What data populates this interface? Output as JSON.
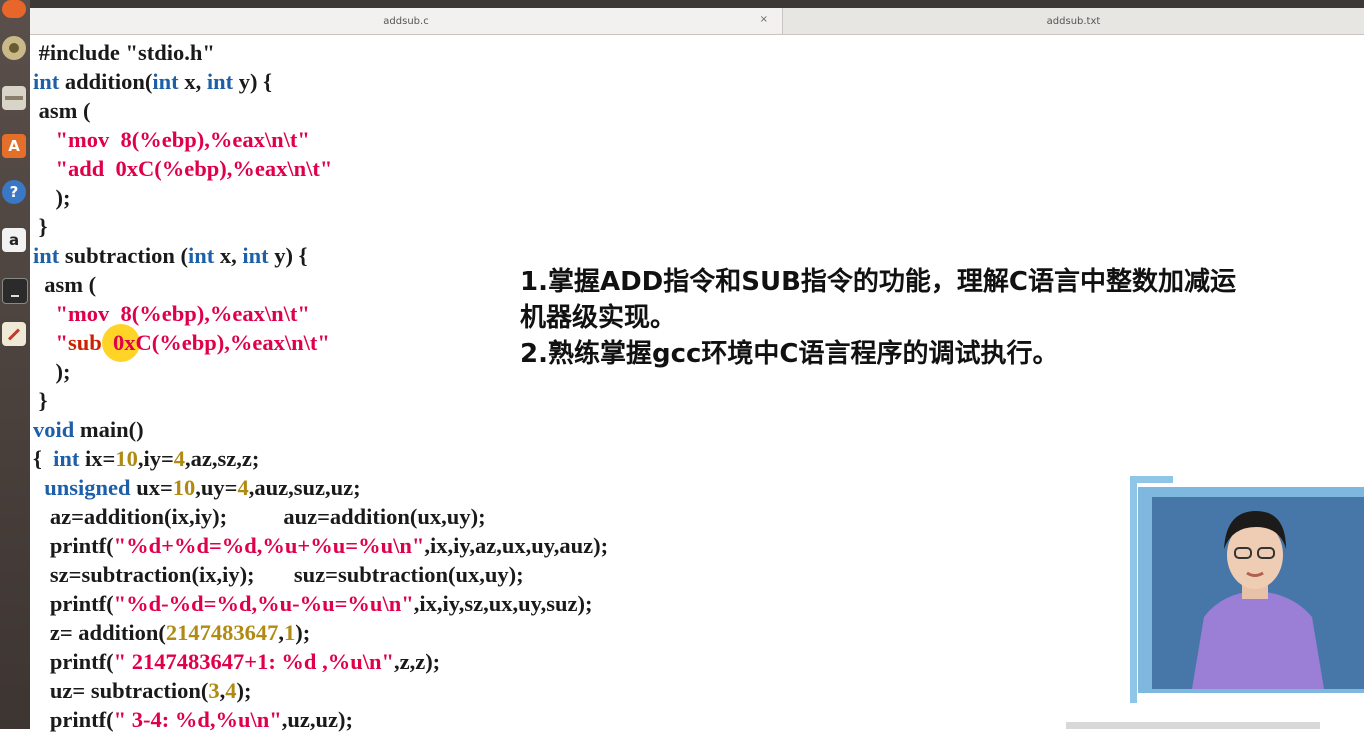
{
  "tabs": [
    {
      "label": "addsub.c",
      "close": "×"
    },
    {
      "label": "addsub.txt"
    }
  ],
  "launcher": {
    "icons": [
      "firefox-icon",
      "disk-icon",
      "files-icon",
      "software-center-icon",
      "help-icon",
      "amazon-icon",
      "terminal-icon",
      "text-editor-icon"
    ],
    "help_glyph": "?",
    "amazon_glyph": "a"
  },
  "code_lines": [
    [
      {
        "t": " #include \"stdio.h\"",
        "c": "plain"
      }
    ],
    [
      {
        "t": "int",
        "c": "kw"
      },
      {
        "t": " addition(",
        "c": "plain"
      },
      {
        "t": "int",
        "c": "kw"
      },
      {
        "t": " x, ",
        "c": "plain"
      },
      {
        "t": "int",
        "c": "kw"
      },
      {
        "t": " y) {",
        "c": "plain"
      }
    ],
    [
      {
        "t": " asm (",
        "c": "plain"
      }
    ],
    [
      {
        "t": "    \"mov  8(%ebp),%eax\\n\\t\"",
        "c": "st"
      }
    ],
    [
      {
        "t": "    \"add  0xC(%ebp),%eax\\n\\t\"",
        "c": "st"
      }
    ],
    [
      {
        "t": "    );",
        "c": "plain"
      }
    ],
    [
      {
        "t": " }",
        "c": "plain"
      }
    ],
    [
      {
        "t": "int",
        "c": "kw"
      },
      {
        "t": " subtraction (",
        "c": "plain"
      },
      {
        "t": "int",
        "c": "kw"
      },
      {
        "t": " x, ",
        "c": "plain"
      },
      {
        "t": "int",
        "c": "kw"
      },
      {
        "t": " y) {",
        "c": "plain"
      }
    ],
    [
      {
        "t": "  asm (",
        "c": "plain"
      }
    ],
    [
      {
        "t": "    \"mov  8(%ebp),%eax\\n\\t\"",
        "c": "st"
      }
    ],
    [
      {
        "t": "    \"",
        "c": "st"
      },
      {
        "t": "sub",
        "c": "sub"
      },
      {
        "t": "  0xC(%ebp),%eax\\n\\t\"",
        "c": "st"
      }
    ],
    [
      {
        "t": "    );",
        "c": "plain"
      }
    ],
    [
      {
        "t": " }",
        "c": "plain"
      }
    ],
    [
      {
        "t": "void",
        "c": "kw"
      },
      {
        "t": " main()",
        "c": "plain"
      }
    ],
    [
      {
        "t": "{  ",
        "c": "plain"
      },
      {
        "t": "int",
        "c": "kw"
      },
      {
        "t": " ix=",
        "c": "plain"
      },
      {
        "t": "10",
        "c": "nm"
      },
      {
        "t": ",iy=",
        "c": "plain"
      },
      {
        "t": "4",
        "c": "nm"
      },
      {
        "t": ",az,sz,z;",
        "c": "plain"
      }
    ],
    [
      {
        "t": "  ",
        "c": "plain"
      },
      {
        "t": "unsigned",
        "c": "kw"
      },
      {
        "t": " ux=",
        "c": "plain"
      },
      {
        "t": "10",
        "c": "nm"
      },
      {
        "t": ",uy=",
        "c": "plain"
      },
      {
        "t": "4",
        "c": "nm"
      },
      {
        "t": ",auz,suz,uz;",
        "c": "plain"
      }
    ],
    [
      {
        "t": "   az=addition(ix,iy);          auz=addition(ux,uy);",
        "c": "plain"
      }
    ],
    [
      {
        "t": "   printf(",
        "c": "plain"
      },
      {
        "t": "\"%d+%d=%d,%u+%u=%u\\n\"",
        "c": "st"
      },
      {
        "t": ",ix,iy,az,ux,uy,auz);",
        "c": "plain"
      }
    ],
    [
      {
        "t": "   sz=subtraction(ix,iy);       suz=subtraction(ux,uy);",
        "c": "plain"
      }
    ],
    [
      {
        "t": "   printf(",
        "c": "plain"
      },
      {
        "t": "\"%d-%d=%d,%u-%u=%u\\n\"",
        "c": "st"
      },
      {
        "t": ",ix,iy,sz,ux,uy,suz);",
        "c": "plain"
      }
    ],
    [
      {
        "t": "   z= addition(",
        "c": "plain"
      },
      {
        "t": "2147483647",
        "c": "nm"
      },
      {
        "t": ",",
        "c": "plain"
      },
      {
        "t": "1",
        "c": "nm"
      },
      {
        "t": ");",
        "c": "plain"
      }
    ],
    [
      {
        "t": "   printf(",
        "c": "plain"
      },
      {
        "t": "\" 2147483647+1: %d ,%u\\n\"",
        "c": "st"
      },
      {
        "t": ",z,z);",
        "c": "plain"
      }
    ],
    [
      {
        "t": "   uz= subtraction(",
        "c": "plain"
      },
      {
        "t": "3",
        "c": "nm"
      },
      {
        "t": ",",
        "c": "plain"
      },
      {
        "t": "4",
        "c": "nm"
      },
      {
        "t": ");",
        "c": "plain"
      }
    ],
    [
      {
        "t": "   printf(",
        "c": "plain"
      },
      {
        "t": "\" 3-4: %d,%u\\n\"",
        "c": "st"
      },
      {
        "t": ",uz,uz);",
        "c": "plain"
      }
    ]
  ],
  "objectives": {
    "line1": "1.掌握ADD指令和SUB指令的功能，理解C语言中整数加减运",
    "line2": "机器级实现。",
    "line3": "2.熟练掌握gcc环境中C语言程序的调试执行。"
  },
  "colors": {
    "keyword": "#1d5fa8",
    "string": "#e0004a",
    "number": "#b08a12",
    "highlight": "#ffcd00",
    "frame": "#8fc6e8"
  }
}
